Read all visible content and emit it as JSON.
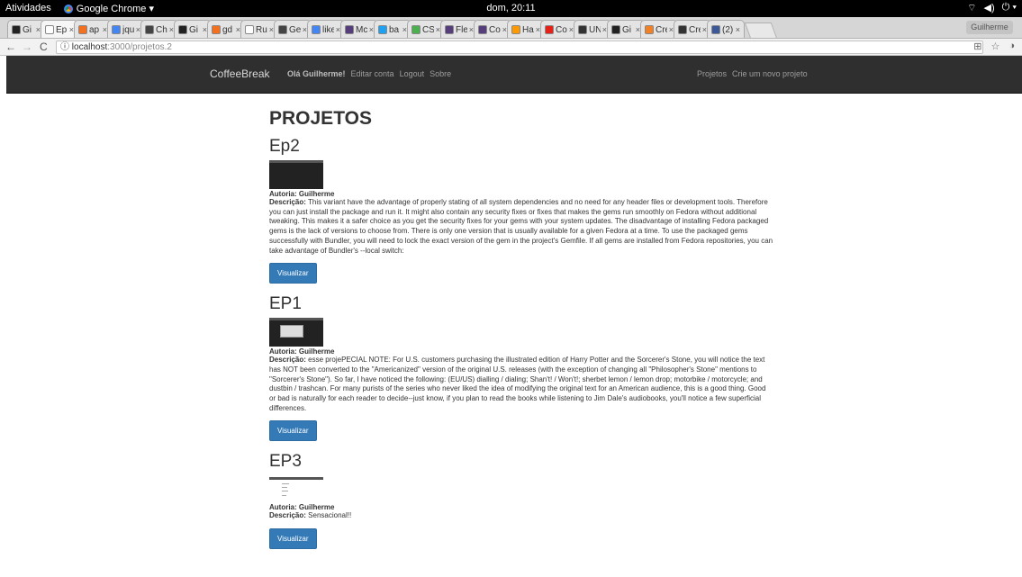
{
  "os_bar": {
    "activities": "Atividades",
    "app_name": "Google Chrome ▾",
    "clock": "dom, 20:11",
    "tray": [
      "⌔",
      "◀)",
      "⏻ ▾"
    ]
  },
  "tabs": [
    {
      "label": "Gi",
      "color": "#222222"
    },
    {
      "label": "Ep",
      "color": "#ffffff",
      "active": true
    },
    {
      "label": "ap",
      "color": "#f37021"
    },
    {
      "label": "jqu",
      "color": "#4285f4"
    },
    {
      "label": "Ch",
      "color": "#444444"
    },
    {
      "label": "Gi",
      "color": "#222222"
    },
    {
      "label": "gd",
      "color": "#f37021"
    },
    {
      "label": "Rui",
      "color": "#ffffff"
    },
    {
      "label": "Ge",
      "color": "#444444"
    },
    {
      "label": "like",
      "color": "#4285f4"
    },
    {
      "label": "Mc",
      "color": "#563d7c"
    },
    {
      "label": "ba",
      "color": "#1da1f2"
    },
    {
      "label": "CS",
      "color": "#4caf50"
    },
    {
      "label": "Fle",
      "color": "#563d7c"
    },
    {
      "label": "Co",
      "color": "#563d7c"
    },
    {
      "label": "Ha",
      "color": "#ff9900"
    },
    {
      "label": "Co",
      "color": "#e62117"
    },
    {
      "label": "UN",
      "color": "#333333"
    },
    {
      "label": "Gi",
      "color": "#222222"
    },
    {
      "label": "Cre",
      "color": "#f48024"
    },
    {
      "label": "Cre",
      "color": "#333333"
    },
    {
      "label": "(2)",
      "color": "#3b5998"
    }
  ],
  "profile_label": "Guilherme",
  "address": {
    "host": "localhost",
    "path": ":3000/projetos.2"
  },
  "navbar": {
    "brand": "CoffeeBreak",
    "greeting": "Olá Guilherme!",
    "edit": "Editar conta",
    "logout": "Logout",
    "about": "Sobre",
    "projects": "Projetos",
    "new_project": "Crie um novo projeto"
  },
  "page": {
    "title": "PROJETOS",
    "author_label": "Autoria:",
    "desc_label": "Descrição:",
    "button_label": "Visualizar"
  },
  "projects": [
    {
      "title": "Ep2",
      "author": "Guilherme",
      "description": "This variant have the advantage of properly stating of all system dependencies and no need for any header files or development tools. Therefore you can just install the package and run it. It might also contain any security fixes or fixes that makes the gems run smoothly on Fedora without additional tweaking. This makes it a safer choice as you get the security fixes for your gems with your system updates. The disadvantage of installing Fedora packaged gems is the lack of versions to choose from. There is only one version that is usually available for a given Fedora at a time. To use the packaged gems successfully with Bundler, you will need to lock the exact version of the gem in the project's Gemfile. If all gems are installed from Fedora repositories, you can take advantage of Bundler's --local switch:"
    },
    {
      "title": "EP1",
      "author": "Guilherme",
      "description": "esse projePECIAL NOTE: For U.S. customers purchasing the illustrated edition of Harry Potter and the Sorcerer's Stone, you will notice the text has NOT been converted to the \"Americanized\" version of the original U.S. releases (with the exception of changing all \"Philosopher's Stone\" mentions to \"Sorcerer's Stone\"). So far, I have noticed the following: (EU/US) dialling / dialing; Shan't! / Won't!; sherbet lemon / lemon drop; motorbike / motorcycle; and dustbin / trashcan. For many purists of the series who never liked the idea of modifying the original text for an American audience, this is a good thing. Good or bad is naturally for each reader to decide--just know, if you plan to read the books while listening to Jim Dale's audiobooks, you'll notice a few superficial differences."
    },
    {
      "title": "EP3",
      "author": "Guilherme",
      "description": "Sensacional!!"
    }
  ]
}
